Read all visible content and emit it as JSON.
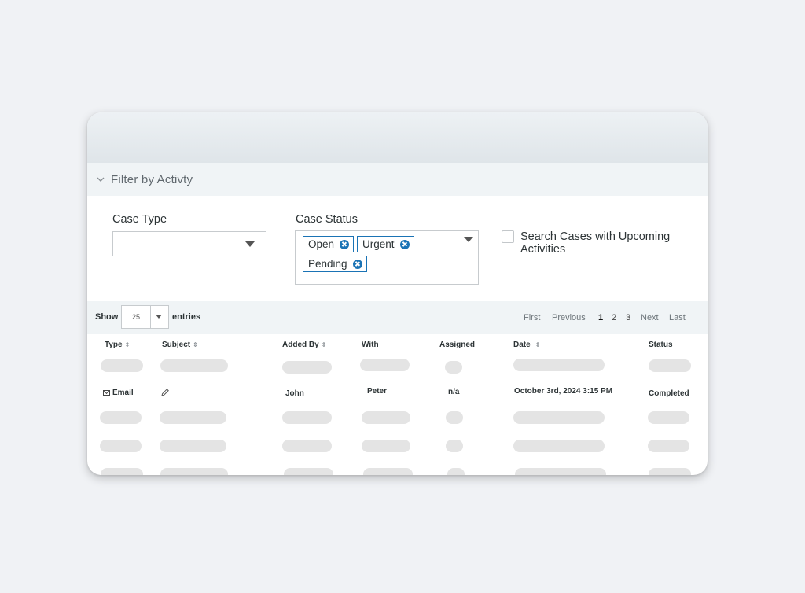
{
  "filter": {
    "title": "Filter by Activty"
  },
  "case_type": {
    "label": "Case Type",
    "value": ""
  },
  "case_status": {
    "label": "Case Status",
    "tags": [
      "Open",
      "Urgent",
      "Pending"
    ]
  },
  "upcoming": {
    "label": "Search Cases with Upcoming Activities",
    "checked": false
  },
  "entries": {
    "show_label": "Show",
    "value": "25",
    "suffix": "entries"
  },
  "pagination": {
    "first": "First",
    "previous": "Previous",
    "pages": [
      "1",
      "2",
      "3"
    ],
    "current": "1",
    "next": "Next",
    "last": "Last"
  },
  "table": {
    "columns": [
      "Type",
      "Subject",
      "Added By",
      "With",
      "Assigned",
      "Date",
      "Status"
    ],
    "row": {
      "type": "Email",
      "subject": "",
      "added_by": "John",
      "with": "Peter",
      "assigned": "n/a",
      "date": "October 3rd, 2024 3:15 PM",
      "status": "Completed"
    }
  },
  "colors": {
    "accent": "#1a73b5",
    "placeholder": "#e4e4e4",
    "bar": "#f0f4f6"
  },
  "icons": [
    "chevron-down-icon",
    "remove-tag-icon",
    "dropdown-arrow-icon",
    "sort-icon",
    "mail-icon",
    "pencil-icon"
  ]
}
